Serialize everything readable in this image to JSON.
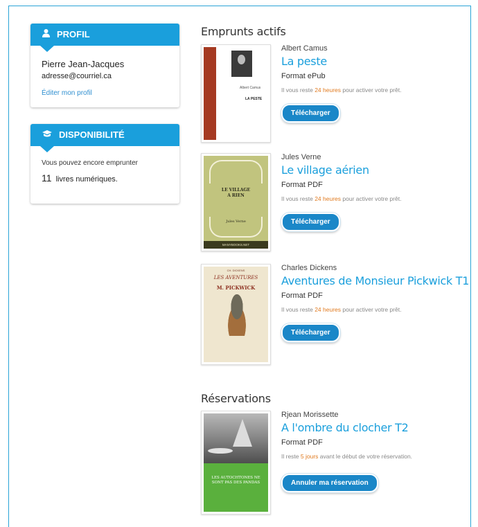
{
  "sidebar": {
    "profile": {
      "header": "PROFIL",
      "icon": "user-icon",
      "name": "Pierre Jean-Jacques",
      "email": "adresse@courriel.ca",
      "edit_link": "Éditer mon profil"
    },
    "availability": {
      "header": "DISPONIBILITÉ",
      "icon": "book-icon",
      "text": "Vous pouvez encore emprunter",
      "count": "11",
      "count_suffix": "livres numériques."
    }
  },
  "loans": {
    "title": "Emprunts actifs",
    "items": [
      {
        "author": "Albert Camus",
        "title": "La peste",
        "format": "Format ePub",
        "notice_prefix": "Il vous reste",
        "notice_highlight": "24 heures",
        "notice_suffix": "pour activer votre prêt.",
        "button": "Télécharger",
        "cover": {
          "author": "Albert Camus",
          "title": "LA PESTE"
        }
      },
      {
        "author": "Jules Verne",
        "title": "Le village aérien",
        "format": "Format PDF",
        "notice_prefix": "Il vous reste",
        "notice_highlight": "24 heures",
        "notice_suffix": "pour activer votre prêt.",
        "button": "Télécharger",
        "cover": {
          "title_line1": "LE VILLAGE",
          "title_line2": "A RIEN",
          "author": "Jules Verne",
          "publisher": "MANYBOOKS.NET"
        }
      },
      {
        "author": "Charles Dickens",
        "title": "Aventures de Monsieur Pickwick T1",
        "format": "Format PDF",
        "notice_prefix": "Il vous reste",
        "notice_highlight": "24 heures",
        "notice_suffix": "pour activer votre prêt.",
        "button": "Télécharger",
        "cover": {
          "author": "CH. DICKENS",
          "title_line1": "LES AVENTURES",
          "title_line2": "M. PICKWICK"
        }
      }
    ]
  },
  "reservations": {
    "title": "Réservations",
    "items": [
      {
        "author": "Rjean Morissette",
        "title": "A l'ombre du clocher T2",
        "format": "Format PDF",
        "notice_prefix": "Il reste",
        "notice_highlight": "5 jours",
        "notice_suffix": "avant le début de votre réservation.",
        "button": "Annuler ma réservation",
        "cover": {
          "title_line1": "LES AUTOCHTONES NE",
          "title_line2": "SONT PAS DES PANDAS"
        }
      }
    ]
  },
  "colors": {
    "accent": "#1a9fdc",
    "button": "#1a87c8",
    "highlight": "#e07a1f"
  }
}
